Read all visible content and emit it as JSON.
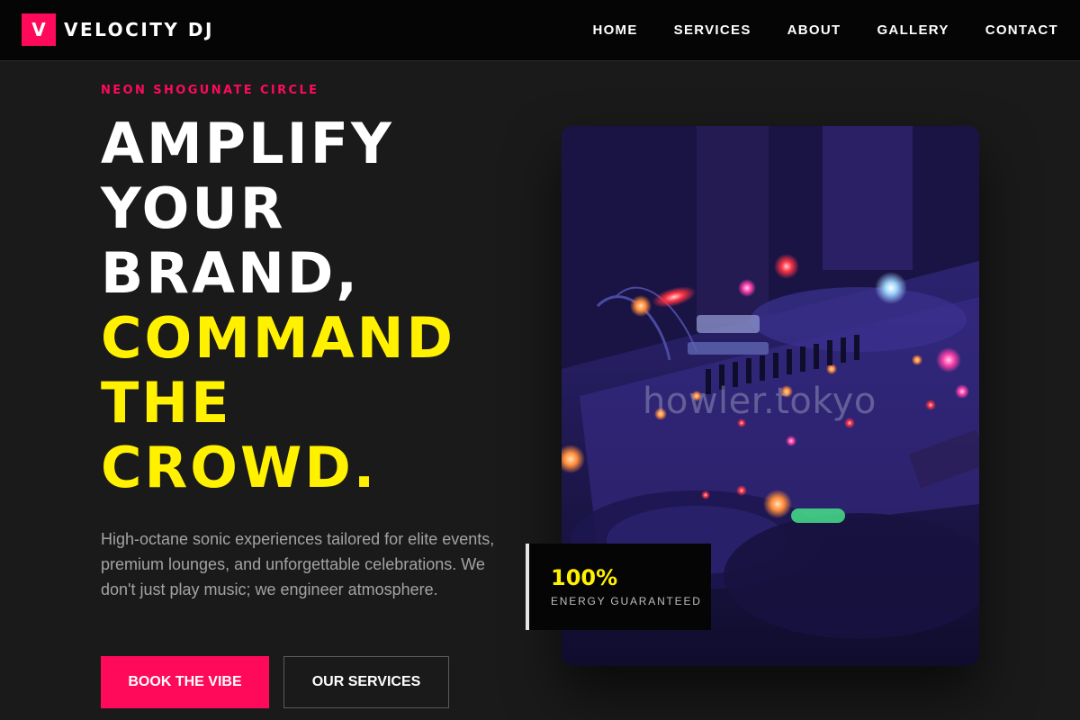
{
  "nav": {
    "brand_letter": "V",
    "brand_name": "VELOCITY DJ",
    "links": [
      "HOME",
      "SERVICES",
      "ABOUT",
      "GALLERY",
      "CONTACT"
    ]
  },
  "hero": {
    "eyebrow": "NEON SHOGUNATE CIRCLE",
    "headline_white": [
      "AMPLIFY",
      "YOUR",
      "BRAND,"
    ],
    "headline_yellow": [
      "COMMAND",
      "THE",
      "CROWD."
    ],
    "subtext": "High-octane sonic experiences tailored for elite events, premium lounges, and unforgettable celebrations. We don't just play music; we engineer atmosphere.",
    "primary_button": "BOOK THE VIBE",
    "secondary_button": "OUR SERVICES",
    "image_watermark": "howler.tokyo",
    "stat_value": "100%",
    "stat_label": "ENERGY GUARANTEED"
  },
  "colors": {
    "accent_pink": "#ff0a5b",
    "accent_yellow": "#fff100",
    "background": "#1a1a1a",
    "nav_background": "#050505"
  }
}
